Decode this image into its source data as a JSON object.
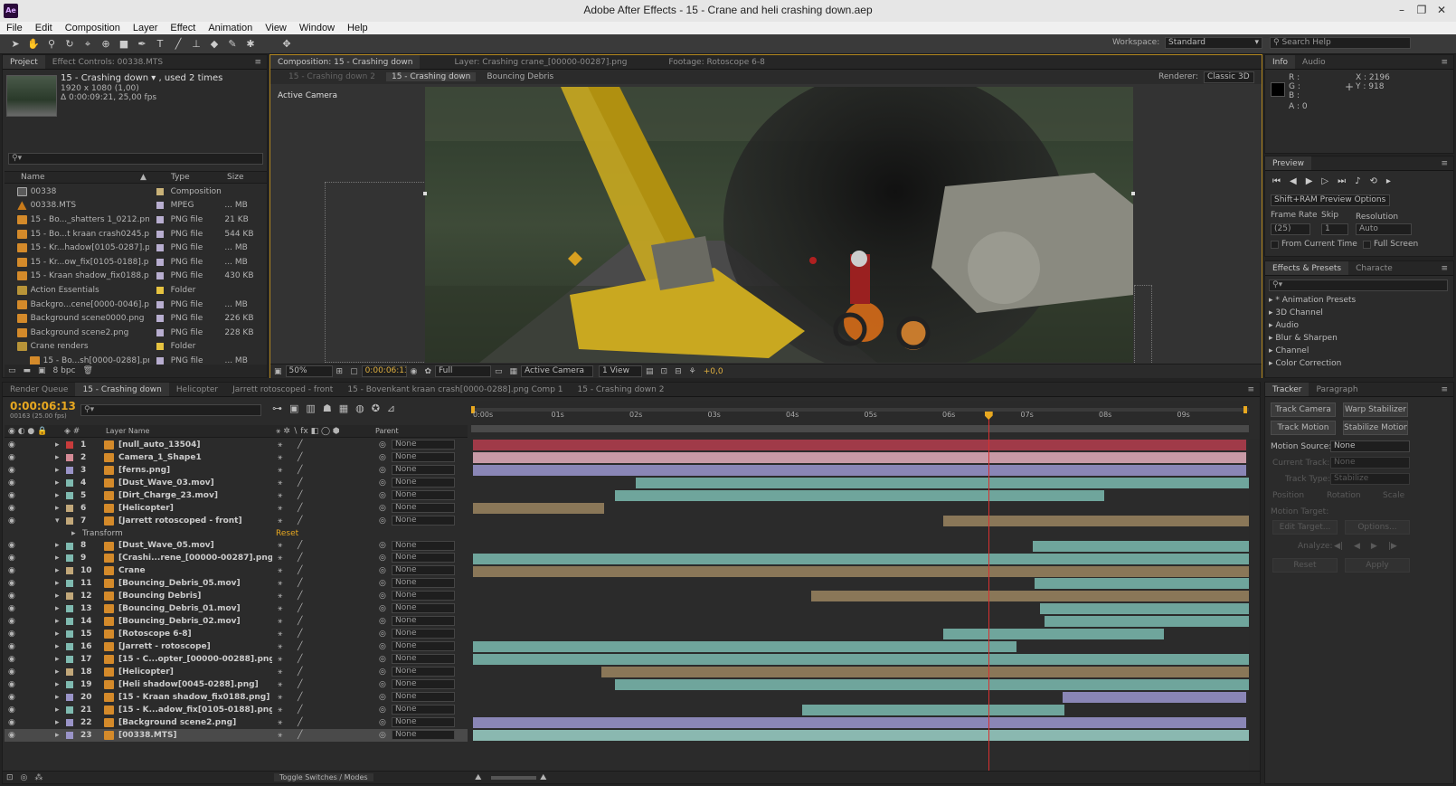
{
  "window": {
    "app_icon": "Ae",
    "title": "Adobe After Effects - 15 - Crane and heli crashing down.aep",
    "min": "–",
    "max": "❐",
    "close": "✕"
  },
  "menu": [
    "File",
    "Edit",
    "Composition",
    "Layer",
    "Effect",
    "Animation",
    "View",
    "Window",
    "Help"
  ],
  "toolbar": {
    "workspace_label": "Workspace:",
    "workspace_value": "Standard",
    "search_placeholder": "Search Help"
  },
  "project": {
    "tabs": [
      "Project",
      "Effect Controls: 00338.MTS"
    ],
    "comp_name": "15 - Crashing down ▾ , used 2 times",
    "comp_size": "1920 x 1080 (1,00)",
    "comp_duration": "Δ 0:00:09:21, 25,00 fps",
    "search": "",
    "columns": [
      "Name",
      "Type",
      "Size"
    ],
    "items": [
      {
        "name": "00338",
        "type": "Composition",
        "size": "",
        "icon": "comp",
        "color": "#c9b278"
      },
      {
        "name": "00338.MTS",
        "type": "MPEG",
        "size": "... MB",
        "icon": "mts",
        "color": "#b8aed0"
      },
      {
        "name": "15 - Bo..._shatters 1_0212.png",
        "type": "PNG file",
        "size": "21 KB",
        "icon": "png",
        "color": "#b8aed0"
      },
      {
        "name": "15 - Bo...t kraan crash0245.png",
        "type": "PNG file",
        "size": "544 KB",
        "icon": "png",
        "color": "#b8aed0"
      },
      {
        "name": "15 - Kr...hadow[0105-0287].png",
        "type": "PNG file",
        "size": "... MB",
        "icon": "png",
        "color": "#b8aed0"
      },
      {
        "name": "15 - Kr...ow_fix[0105-0188].png",
        "type": "PNG file",
        "size": "... MB",
        "icon": "png",
        "color": "#b8aed0"
      },
      {
        "name": "15 - Kraan shadow_fix0188.png",
        "type": "PNG file",
        "size": "430 KB",
        "icon": "png",
        "color": "#b8aed0"
      },
      {
        "name": "Action Essentials",
        "type": "Folder",
        "size": "",
        "icon": "folder",
        "color": "#e6c340"
      },
      {
        "name": "Backgro...cene[0000-0046].png",
        "type": "PNG file",
        "size": "... MB",
        "icon": "png",
        "color": "#b8aed0"
      },
      {
        "name": "Background scene0000.png",
        "type": "PNG file",
        "size": "226 KB",
        "icon": "png",
        "color": "#b8aed0"
      },
      {
        "name": "Background scene2.png",
        "type": "PNG file",
        "size": "228 KB",
        "icon": "png",
        "color": "#b8aed0"
      },
      {
        "name": "Crane renders",
        "type": "Folder",
        "size": "",
        "icon": "folder",
        "color": "#e6c340"
      },
      {
        "name": "15 - Bo...sh[0000-0288].png",
        "type": "PNG file",
        "size": "... MB",
        "icon": "png",
        "color": "#b8aed0"
      }
    ],
    "bpc": "8 bpc"
  },
  "viewer": {
    "tabs": [
      "Composition: 15 - Crashing down",
      "Layer: Crashing crane_[00000-00287].png",
      "Footage: Rotoscope 6-8"
    ],
    "breadcrumbs": [
      "15 - Crashing down 2",
      "15 - Crashing down",
      "Bouncing Debris"
    ],
    "renderer_label": "Renderer:",
    "renderer_value": "Classic 3D",
    "camera_label": "Active Camera",
    "zoom": "50%",
    "timecode": "0:00:06:13",
    "resolution": "Full",
    "camera": "Active Camera",
    "views": "1 View",
    "exposure": "+0,0"
  },
  "info": {
    "tabs": [
      "Info",
      "Audio"
    ],
    "r": "R :",
    "g": "G :",
    "b": "B :",
    "a": "A : 0",
    "x": "X : 2196",
    "y": "Y : 918"
  },
  "preview": {
    "tab": "Preview",
    "ram_options": "Shift+RAM Preview Options",
    "frame_rate_label": "Frame Rate",
    "skip_label": "Skip",
    "resolution_label": "Resolution",
    "frame_rate": "(25)",
    "skip": "1",
    "resolution": "Auto",
    "from_current": "From Current Time",
    "full_screen": "Full Screen"
  },
  "effects": {
    "tabs": [
      "Effects & Presets",
      "Characte"
    ],
    "items": [
      "* Animation Presets",
      "3D Channel",
      "Audio",
      "Blur & Sharpen",
      "Channel",
      "Color Correction"
    ]
  },
  "tracker": {
    "tabs": [
      "Tracker",
      "Paragraph"
    ],
    "track_camera": "Track Camera",
    "warp_stabilizer": "Warp Stabilizer",
    "track_motion": "Track Motion",
    "stabilize_motion": "Stabilize Motion",
    "motion_source_label": "Motion Source:",
    "motion_source": "None",
    "current_track_label": "Current Track:",
    "current_track": "None",
    "track_type_label": "Track Type:",
    "track_type": "Stabilize",
    "position": "Position",
    "rotation": "Rotation",
    "scale": "Scale",
    "motion_target": "Motion Target:",
    "edit_target": "Edit Target...",
    "options": "Options...",
    "analyze": "Analyze:",
    "reset": "Reset",
    "apply": "Apply"
  },
  "timeline": {
    "tabs": [
      "Render Queue",
      "15 - Crashing down",
      "Helicopter",
      "Jarrett rotoscoped - front",
      "15 - Bovenkant kraan crash[0000-0288].png Comp 1",
      "15 - Crashing down 2"
    ],
    "timecode": "0:00:06:13",
    "frame_info": "00163 (25.00 fps)",
    "layer_name_header": "Layer Name",
    "parent_header": "Parent",
    "ruler": [
      "0:00s",
      "01s",
      "02s",
      "03s",
      "04s",
      "05s",
      "06s",
      "07s",
      "08s",
      "09s"
    ],
    "transform_label": "Transform",
    "reset_label": "Reset",
    "toggle_label": "Toggle Switches / Modes",
    "playhead_fraction": 0.664,
    "layers": [
      {
        "num": "1",
        "name": "[null_auto_13504]",
        "label": "#c83c3c",
        "bar": {
          "start": 0,
          "end": 0.997,
          "color": "#a03a48"
        }
      },
      {
        "num": "2",
        "name": "Camera_1_Shape1",
        "label": "#d48a96",
        "bar": {
          "start": 0,
          "end": 0.997,
          "color": "#c89aa6"
        }
      },
      {
        "num": "3",
        "name": "[ferns.png]",
        "label": "#9a94c8",
        "bar": {
          "start": 0,
          "end": 0.997,
          "color": "#8a86b6"
        }
      },
      {
        "num": "4",
        "name": "[Dust_Wave_03.mov]",
        "label": "#7fbab0",
        "bar": {
          "start": 0.21,
          "end": 1,
          "color": "#6fa59c"
        }
      },
      {
        "num": "5",
        "name": "[Dirt_Charge_23.mov]",
        "label": "#7fbab0",
        "bar": {
          "start": 0.183,
          "end": 0.814,
          "color": "#6fa59c"
        }
      },
      {
        "num": "6",
        "name": "[Helicopter]",
        "label": "#c2a87a",
        "bar": {
          "start": 0,
          "end": 0.169,
          "color": "#8a7758"
        }
      },
      {
        "num": "7",
        "name": "[Jarrett rotoscoped - front]",
        "label": "#c2a87a",
        "bar": {
          "start": 0.606,
          "end": 1,
          "color": "#8a7758"
        }
      },
      {
        "num": "8",
        "name": "[Dust_Wave_05.mov]",
        "label": "#7fbab0",
        "bar": {
          "start": 0.721,
          "end": 1,
          "color": "#6fa59c"
        }
      },
      {
        "num": "9",
        "name": "[Crashi...rene_[00000-00287].png]",
        "label": "#7fbab0",
        "bar": {
          "start": 0,
          "end": 1,
          "color": "#6fa59c"
        }
      },
      {
        "num": "10",
        "name": "Crane",
        "label": "#c2a87a",
        "bar": {
          "start": 0,
          "end": 1,
          "color": "#8a7758"
        }
      },
      {
        "num": "11",
        "name": "[Bouncing_Debris_05.mov]",
        "label": "#7fbab0",
        "bar": {
          "start": 0.724,
          "end": 1,
          "color": "#6fa59c"
        }
      },
      {
        "num": "12",
        "name": "[Bouncing Debris]",
        "label": "#c2a87a",
        "bar": {
          "start": 0.436,
          "end": 1,
          "color": "#8a7758"
        }
      },
      {
        "num": "13",
        "name": "[Bouncing_Debris_01.mov]",
        "label": "#7fbab0",
        "bar": {
          "start": 0.731,
          "end": 1,
          "color": "#6fa59c"
        }
      },
      {
        "num": "14",
        "name": "[Bouncing_Debris_02.mov]",
        "label": "#7fbab0",
        "bar": {
          "start": 0.737,
          "end": 1,
          "color": "#6fa59c"
        }
      },
      {
        "num": "15",
        "name": "[Rotoscope 6-8]",
        "label": "#7fbab0",
        "bar": {
          "start": 0.606,
          "end": 0.891,
          "color": "#6fa59c"
        }
      },
      {
        "num": "16",
        "name": "[Jarrett - rotoscope]",
        "label": "#7fbab0",
        "bar": {
          "start": 0,
          "end": 0.7,
          "color": "#6fa59c"
        }
      },
      {
        "num": "17",
        "name": "[15 - C...opter_[00000-00288].png]",
        "label": "#7fbab0",
        "bar": {
          "start": 0,
          "end": 1,
          "color": "#6fa59c"
        }
      },
      {
        "num": "18",
        "name": "[Helicopter]",
        "label": "#c2a87a",
        "bar": {
          "start": 0.165,
          "end": 1,
          "color": "#8a7758"
        }
      },
      {
        "num": "19",
        "name": "[Heli shadow[0045-0288].png]",
        "label": "#7fbab0",
        "bar": {
          "start": 0.183,
          "end": 1,
          "color": "#6fa59c"
        }
      },
      {
        "num": "20",
        "name": "[15 - Kraan shadow_fix0188.png]",
        "label": "#9a94c8",
        "bar": {
          "start": 0.76,
          "end": 0.997,
          "color": "#8a86b6"
        }
      },
      {
        "num": "21",
        "name": "[15 - K...adow_fix[0105-0188].png]",
        "label": "#7fbab0",
        "bar": {
          "start": 0.424,
          "end": 0.762,
          "color": "#6fa59c"
        }
      },
      {
        "num": "22",
        "name": "[Background scene2.png]",
        "label": "#9a94c8",
        "bar": {
          "start": 0,
          "end": 0.997,
          "color": "#8a86b6"
        }
      },
      {
        "num": "23",
        "name": "[00338.MTS]",
        "label": "#9a94c8",
        "bar": {
          "start": 0,
          "end": 1,
          "color": "#8ab8b0"
        }
      }
    ],
    "parent_value": "None"
  },
  "colors": {
    "accent": "#f0a820",
    "playhead": "#d83030",
    "panel_bg": "#2b2b2b"
  }
}
